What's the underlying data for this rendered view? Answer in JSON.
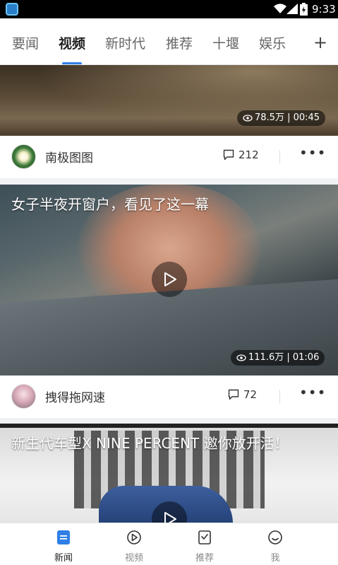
{
  "status_bar": {
    "time": "9:33"
  },
  "tabs": {
    "items": [
      {
        "label": "要闻"
      },
      {
        "label": "视频"
      },
      {
        "label": "新时代"
      },
      {
        "label": "推荐"
      },
      {
        "label": "十堰"
      },
      {
        "label": "娱乐"
      }
    ],
    "active": "视频",
    "add_label": "+"
  },
  "feed": [
    {
      "title": "",
      "views": "78.5万",
      "duration": "00:45",
      "author": "南极图图",
      "comments": "212"
    },
    {
      "title": "女子半夜开窗户，看见了这一幕",
      "views": "111.6万",
      "duration": "01:06",
      "author": "拽得拖网速",
      "comments": "72"
    },
    {
      "title": "新生代车型X NINE PERCENT 邀你放开活！",
      "views": "",
      "duration": "",
      "author": "",
      "comments": ""
    }
  ],
  "more_label": "•••",
  "bottom_nav": {
    "items": [
      {
        "label": "新闻",
        "icon": "news-icon"
      },
      {
        "label": "视频",
        "icon": "video-icon"
      },
      {
        "label": "推荐",
        "icon": "recommend-icon"
      },
      {
        "label": "我",
        "icon": "profile-icon"
      }
    ],
    "active": "新闻"
  },
  "colors": {
    "accent": "#2f7fe6",
    "status_bar": "#000000",
    "text_primary": "#222222",
    "text_secondary": "#888888"
  }
}
